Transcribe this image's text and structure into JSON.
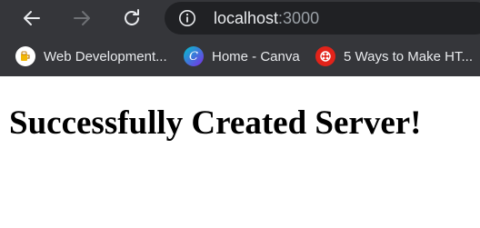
{
  "browser": {
    "address_bar": {
      "host": "localhost",
      "port": ":3000"
    },
    "bookmarks": [
      {
        "label": "Web Development...",
        "icon": "bookmark-favicon-webdev-icon"
      },
      {
        "label": "Home - Canva",
        "icon": "canva-icon",
        "icon_letter": "C"
      },
      {
        "label": "5 Ways to Make HT...",
        "icon": "red-circle-favicon-icon"
      }
    ],
    "colors": {
      "chrome_bg": "#35363a",
      "omnibox_bg": "#202124",
      "text_primary": "#e8eaed",
      "text_muted": "#9aa0a6"
    }
  },
  "page": {
    "heading": "Successfully Created Server!"
  }
}
